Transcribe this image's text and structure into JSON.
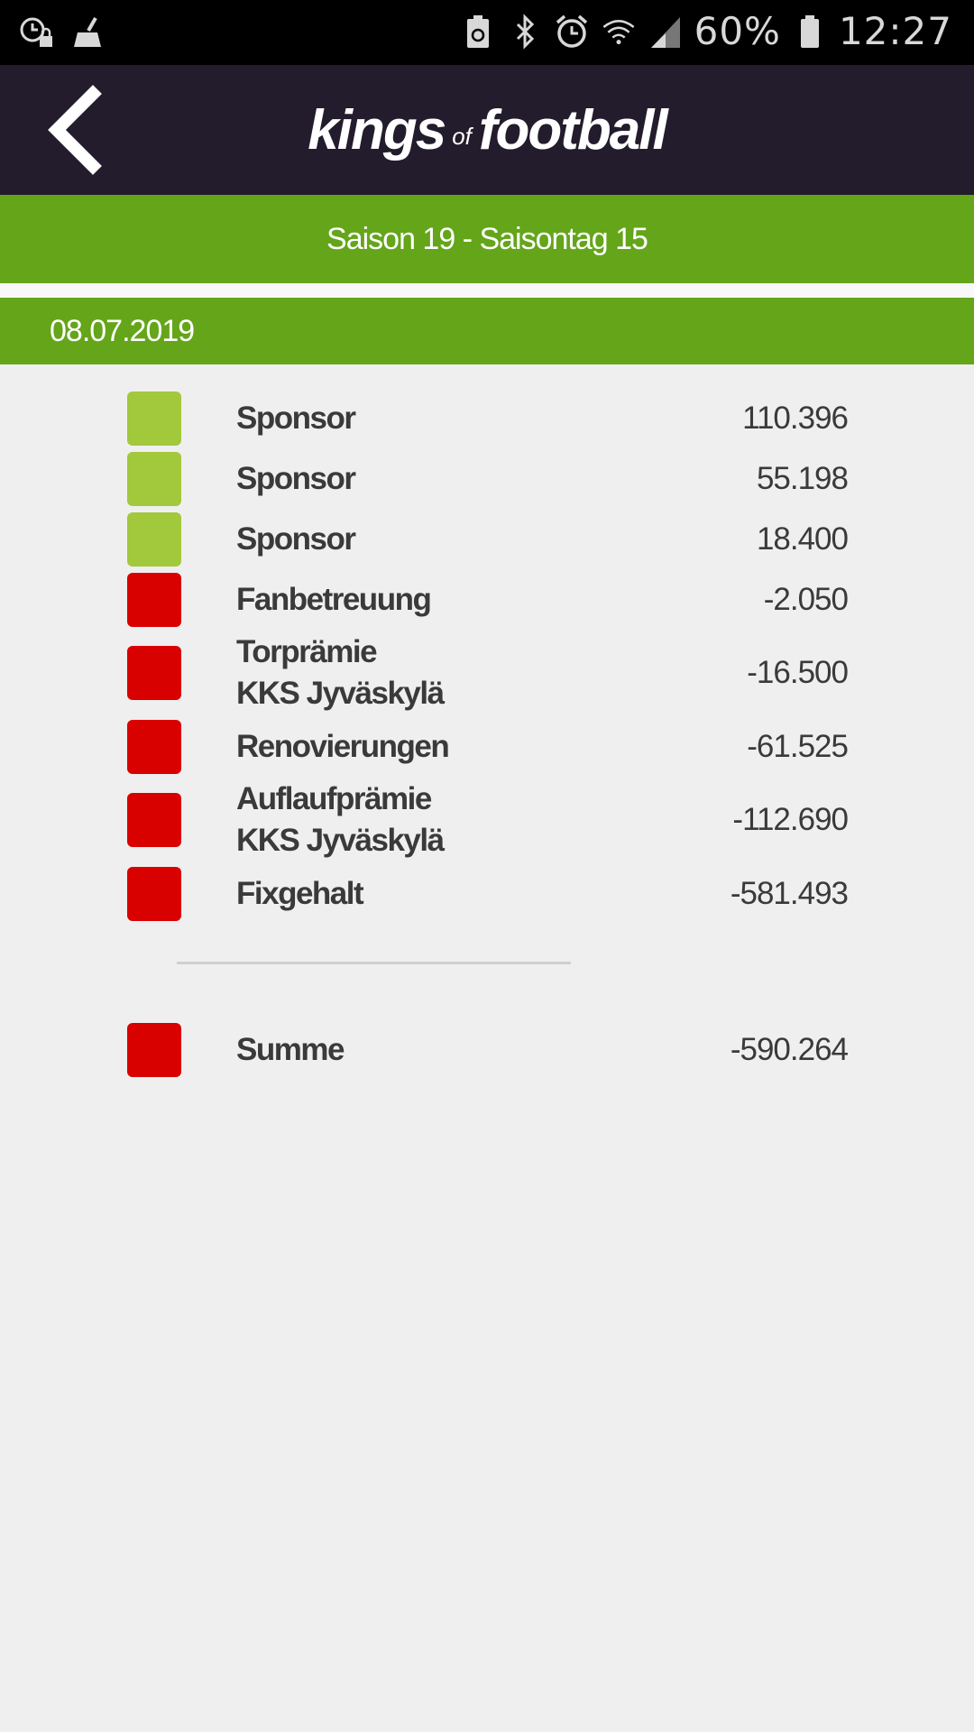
{
  "status_bar": {
    "left_icons": [
      "alarm-lock-icon",
      "cleaner-icon"
    ],
    "right_icons": [
      "battery-saver-icon",
      "bluetooth-icon",
      "alarm-clock-icon",
      "wifi-icon",
      "signal-icon"
    ],
    "battery": "60%",
    "time": "12:27"
  },
  "header": {
    "logo_part1": "kings",
    "logo_part2": "of",
    "logo_part3": "football"
  },
  "season": "Saison 19 - Saisontag 15",
  "date": "08.07.2019",
  "colors": {
    "positive": "#a2c83c",
    "negative": "#d90000",
    "green_bar": "#64a51a",
    "header": "#231c2c"
  },
  "entries": [
    {
      "label": "Sponsor",
      "amount": "110.396",
      "type": "positive"
    },
    {
      "label": "Sponsor",
      "amount": "55.198",
      "type": "positive"
    },
    {
      "label": "Sponsor",
      "amount": "18.400",
      "type": "positive"
    },
    {
      "label": "Fanbetreuung",
      "amount": "-2.050",
      "type": "negative"
    },
    {
      "label": "Torprämie\nKKS Jyväskylä",
      "amount": "-16.500",
      "type": "negative"
    },
    {
      "label": "Renovierungen",
      "amount": "-61.525",
      "type": "negative"
    },
    {
      "label": "Auflaufprämie\nKKS Jyväskylä",
      "amount": "-112.690",
      "type": "negative"
    },
    {
      "label": "Fixgehalt",
      "amount": "-581.493",
      "type": "negative"
    }
  ],
  "total": {
    "label": "Summe",
    "amount": "-590.264",
    "type": "negative"
  }
}
